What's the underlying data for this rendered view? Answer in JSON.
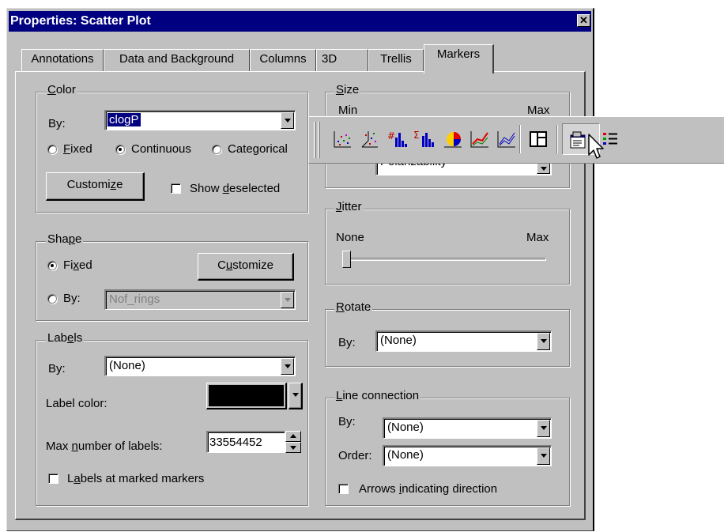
{
  "window": {
    "title": "Properties: Scatter Plot",
    "close_glyph": "✕"
  },
  "tabs": [
    {
      "label": "Annotations"
    },
    {
      "label": "Data and Background"
    },
    {
      "label": "Columns"
    },
    {
      "label": "3D"
    },
    {
      "label": "Trellis"
    },
    {
      "label": "Markers"
    }
  ],
  "color": {
    "title_u": "C",
    "title_rest": "olor",
    "by_label": "By:",
    "by_value": "clogP",
    "fixed_u": "F",
    "fixed_rest": "ixed",
    "continuous": "Continuous",
    "categorical": "Categorical",
    "selected_mode": "Continuous",
    "customize_pre": "Customi",
    "customize_u": "z",
    "customize_post": "e",
    "show_deselected_pre": "Show ",
    "show_deselected_u": "d",
    "show_deselected_post": "eselected"
  },
  "shape": {
    "title_pre": "Sha",
    "title_u": "p",
    "title_post": "e",
    "fixed_pre": "Fi",
    "fixed_u": "x",
    "fixed_post": "ed",
    "by_label": "By:",
    "by_value": "Nof_rings",
    "customize_pre": "C",
    "customize_u": "u",
    "customize_post": "stomize"
  },
  "labels": {
    "title_pre": "Lab",
    "title_u": "e",
    "title_post": "ls",
    "by_label": "By:",
    "by_value": "(None)",
    "label_color": "Label color:",
    "label_color_value": "#000000",
    "max_pre": "Max ",
    "max_u": "n",
    "max_post": "umber of labels:",
    "max_value": "33554452",
    "marked_pre": "L",
    "marked_u": "a",
    "marked_post": "bels at marked markers"
  },
  "size": {
    "title_u": "S",
    "title_rest": "ize",
    "min": "Min",
    "max": "Max",
    "by_value": "Polarizability"
  },
  "jitter": {
    "title_u": "J",
    "title_rest": "itter",
    "none": "None",
    "max": "Max",
    "level": 0
  },
  "rotate": {
    "title_u": "R",
    "title_rest": "otate",
    "by_label": "By:",
    "by_value": "(None)"
  },
  "line_connection": {
    "title_u": "L",
    "title_rest": "ine connection",
    "by_label": "By:",
    "by_value": "(None)",
    "order_label": "Order:",
    "order_value": "(None)",
    "arrows_pre": "Arrows ",
    "arrows_u": "i",
    "arrows_post": "ndicating direction"
  },
  "toolbar": {
    "icons": [
      "scatter-plot-icon",
      "3d-scatter-plot-icon",
      "histogram-icon",
      "bar-chart-icon",
      "pie-chart-icon",
      "line-chart-icon",
      "profile-chart-icon",
      "table-icon",
      "properties-icon",
      "legend-icon"
    ]
  }
}
